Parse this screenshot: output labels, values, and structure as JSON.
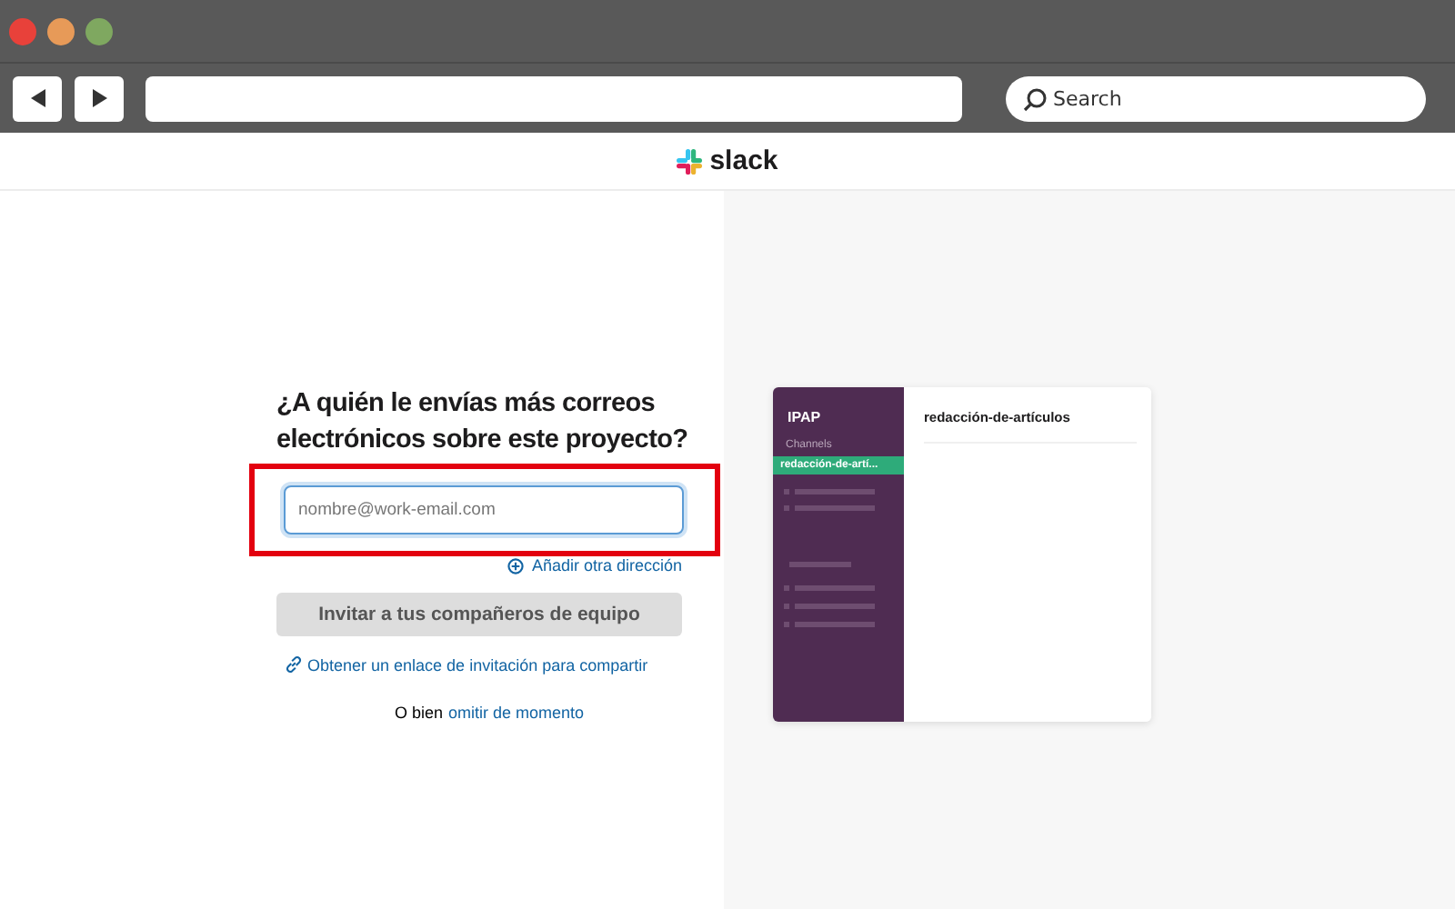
{
  "browser": {
    "search": {
      "placeholder": "Search"
    }
  },
  "header": {
    "logo_text": "slack"
  },
  "form": {
    "heading": "¿A quién le envías más correos electrónicos sobre este proyecto?",
    "email": {
      "placeholder": "nombre@work-email.com",
      "highlighted": true
    },
    "add_link": "Añadir otra dirección",
    "invite_button": {
      "label": "Invitar a tus compañeros de equipo",
      "disabled": true
    },
    "share_link": "Obtener un enlace de invitación para compartir",
    "skip_prefix": "O bien",
    "skip_link": "omitir de momento"
  },
  "preview": {
    "workspace": "IPAP",
    "section": "Channels",
    "channels": [
      {
        "name": "redacción-de-artí...",
        "selected": true
      }
    ],
    "channel_title": "redacción-de-artículos"
  }
}
